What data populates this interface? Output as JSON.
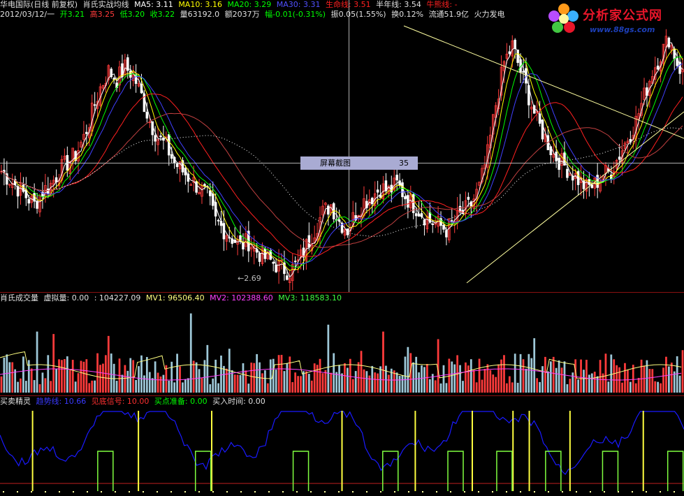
{
  "main_header": {
    "stock": "华电国际(日线 前复权)",
    "indicator": "肖氏实战均线",
    "ma5": "MA5: 3.11",
    "ma10": "MA10: 3.16",
    "ma20": "MA20: 3.29",
    "ma30": "MA30: 3.31",
    "lifeline": "生命线: 3.51",
    "halfyear": "半年线: 3.54",
    "bull": "牛熊线: -"
  },
  "info_row": {
    "date": "2012/03/12/一",
    "open": "开3.21",
    "high": "高3.25",
    "low": "低3.20",
    "close": "收3.22",
    "volume": "量63192.0",
    "amount": "额2037万",
    "change": "幅-0.01(-0.31%)",
    "amplitude": "振0.05(1.55%)",
    "turnover": "换0.12%",
    "float": "流通51.9亿",
    "sector": "火力发电"
  },
  "tooltip": {
    "label": "屏幕截图",
    "value": "35"
  },
  "low_price_label": "2.69",
  "logo": {
    "title": "分析家公式网",
    "url": "www.88gs.com"
  },
  "volume_header": {
    "title": "肖氏成交量",
    "virtual": "虚拟量: 0.00",
    "value": ": 104227.09",
    "mv1": "MV1: 96506.40",
    "mv2": "MV2: 102388.60",
    "mv3": "MV3: 118583.10"
  },
  "signal_header": {
    "title": "买卖精灵",
    "trend": "趋势线: 10.66",
    "bottom": "见底信号: 10.00",
    "prepare": "买点准备: 0.00",
    "buytime": "买入时间: 0.00"
  },
  "colors": {
    "up": "#ff3b3b",
    "down": "#ffffff",
    "ma5": "#ffffff",
    "ma10": "#ffff00",
    "ma20": "#00ff00",
    "ma30": "#4040ff",
    "life": "#ff2020",
    "trend": "#1a1aff",
    "signal_yellow": "#ffff40",
    "signal_green": "#80ff40"
  },
  "chart_data": {
    "type": "line",
    "price_axis_range": [
      2.6,
      4.2
    ],
    "low_marker": 2.69,
    "closes": [
      3.3,
      3.25,
      3.2,
      3.15,
      3.1,
      3.18,
      3.22,
      3.3,
      3.35,
      3.4,
      3.5,
      3.65,
      3.8,
      3.9,
      3.85,
      3.92,
      3.88,
      3.75,
      3.6,
      3.5,
      3.45,
      3.35,
      3.3,
      3.25,
      3.2,
      3.15,
      3.0,
      2.95,
      2.9,
      2.85,
      2.88,
      2.82,
      2.78,
      2.75,
      2.72,
      2.7,
      2.75,
      2.85,
      2.95,
      3.05,
      3.1,
      3.0,
      2.95,
      3.05,
      3.12,
      3.15,
      3.2,
      3.18,
      3.22,
      3.15,
      3.1,
      3.05,
      3.0,
      2.98,
      2.95,
      3.0,
      3.05,
      3.1,
      3.2,
      3.4,
      3.7,
      3.95,
      4.05,
      3.9,
      3.75,
      3.6,
      3.5,
      3.4,
      3.35,
      3.3,
      3.25,
      3.2,
      3.22,
      3.28,
      3.3,
      3.4,
      3.5,
      3.6,
      3.75,
      3.9,
      4.0,
      4.1,
      3.95,
      3.85
    ],
    "signals": {
      "yellow_positions": [
        4,
        17,
        26,
        42,
        51,
        58,
        63,
        65,
        70,
        79,
        88
      ],
      "green_positions": [
        12,
        24,
        36,
        47,
        55,
        61,
        67,
        74,
        82
      ]
    }
  }
}
